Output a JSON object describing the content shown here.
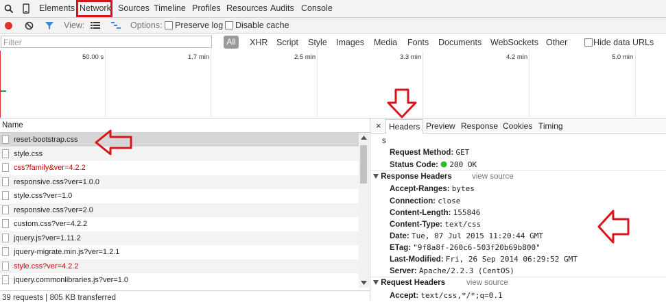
{
  "topbar": {
    "tabs": [
      "Elements",
      "Network",
      "Sources",
      "Timeline",
      "Profiles",
      "Resources",
      "Audits",
      "Console"
    ]
  },
  "toolbar": {
    "view_label": "View:",
    "options_label": "Options:",
    "preserve_log": "Preserve log",
    "disable_cache": "Disable cache"
  },
  "filter": {
    "placeholder": "Filter",
    "types": [
      "All",
      "XHR",
      "Script",
      "Style",
      "Images",
      "Media",
      "Fonts",
      "Documents",
      "WebSockets",
      "Other"
    ],
    "hide_data_urls": "Hide data URLs"
  },
  "overview": {
    "ticks": [
      "50.00 s",
      "1.7 min",
      "2.5 min",
      "3.3 min",
      "4.2 min",
      "5.0 min"
    ]
  },
  "requests": {
    "column_name": "Name",
    "rows": [
      {
        "name": "reset-bootstrap.css",
        "error": false,
        "selected": true
      },
      {
        "name": "style.css",
        "error": false,
        "selected": false
      },
      {
        "name": "css?family&ver=4.2.2",
        "error": true,
        "selected": false
      },
      {
        "name": "responsive.css?ver=1.0.0",
        "error": false,
        "selected": false
      },
      {
        "name": "style.css?ver=1.0",
        "error": false,
        "selected": false
      },
      {
        "name": "responsive.css?ver=2.0",
        "error": false,
        "selected": false
      },
      {
        "name": "custom.css?ver=4.2.2",
        "error": false,
        "selected": false
      },
      {
        "name": "jquery.js?ver=1.11.2",
        "error": false,
        "selected": false
      },
      {
        "name": "jquery-migrate.min.js?ver=1.2.1",
        "error": false,
        "selected": false
      },
      {
        "name": "style.css?ver=4.2.2",
        "error": true,
        "selected": false
      },
      {
        "name": "jquery.commonlibraries.js?ver=1.0",
        "error": false,
        "selected": false
      }
    ],
    "status": "39 requests | 805 KB transferred"
  },
  "detail": {
    "tabs": [
      "Headers",
      "Preview",
      "Response",
      "Cookies",
      "Timing"
    ],
    "close": "×",
    "truncated": "s",
    "general": [
      {
        "key": "Request Method:",
        "value": "GET"
      },
      {
        "key": "Status Code:",
        "value": "200 OK"
      }
    ],
    "response_headers_title": "Response Headers",
    "view_source": "view source",
    "response_headers": [
      {
        "key": "Accept-Ranges:",
        "value": "bytes"
      },
      {
        "key": "Connection:",
        "value": "close"
      },
      {
        "key": "Content-Length:",
        "value": "155846"
      },
      {
        "key": "Content-Type:",
        "value": "text/css"
      },
      {
        "key": "Date:",
        "value": "Tue, 07 Jul 2015 11:20:44 GMT"
      },
      {
        "key": "ETag:",
        "value": "\"9f8a8f-260c6-503f20b69b800\""
      },
      {
        "key": "Last-Modified:",
        "value": "Fri, 26 Sep 2014 06:29:52 GMT"
      },
      {
        "key": "Server:",
        "value": "Apache/2.2.3 (CentOS)"
      }
    ],
    "request_headers_title": "Request Headers",
    "request_headers": [
      {
        "key": "Accept:",
        "value": "text/css,*/*;q=0.1"
      }
    ]
  },
  "colors": {
    "error_text": "#c80000",
    "annotation_red": "#d8141b",
    "status_green": "#2dbb2d",
    "record_red": "#e0312b",
    "filter_blue": "#3b84d8"
  }
}
